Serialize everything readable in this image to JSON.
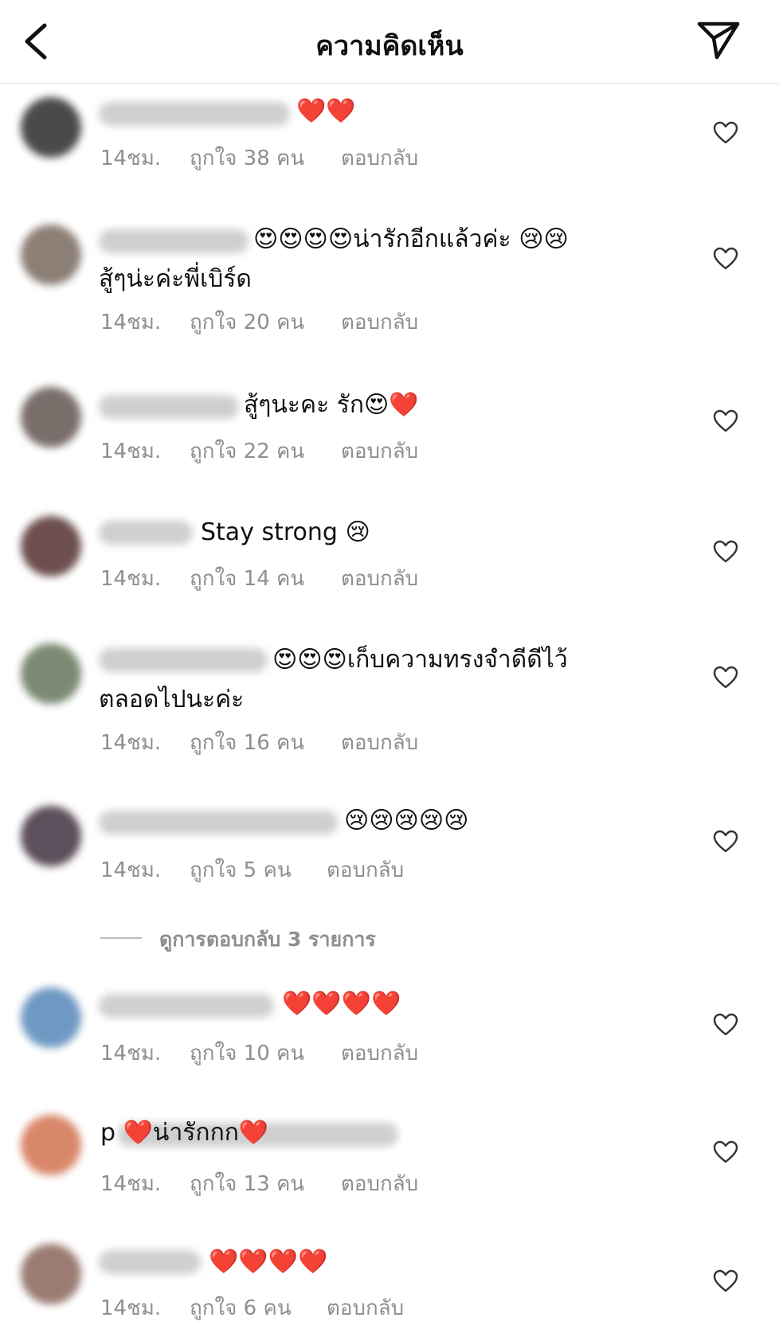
{
  "header": {
    "title": "ความคิดเห็น",
    "back_icon": "chevron-left-icon",
    "send_icon": "paper-plane-icon"
  },
  "comments": [
    {
      "text_first": "❤️❤️",
      "text_second": "",
      "time": "14ชม.",
      "likes": "ถูกใจ 38 คน",
      "reply": "ตอบกลับ",
      "avatar_color": "#4a4a4a"
    },
    {
      "text_first": "😍😍😍😍น่ารักอีกแล้วค่ะ 😢😢",
      "text_second": "สู้ๆน่ะค่ะพี่เบิร์ด",
      "time": "14ชม.",
      "likes": "ถูกใจ 20 คน",
      "reply": "ตอบกลับ",
      "avatar_color": "#8c7f76"
    },
    {
      "text_first": "สู้ๆนะคะ รัก😍❤️",
      "text_second": "",
      "time": "14ชม.",
      "likes": "ถูกใจ 22 คน",
      "reply": "ตอบกลับ",
      "avatar_color": "#7a6e6b"
    },
    {
      "text_first": "Stay strong 😢",
      "text_second": "",
      "time": "14ชม.",
      "likes": "ถูกใจ 14 คน",
      "reply": "ตอบกลับ",
      "avatar_color": "#6e4f4f"
    },
    {
      "text_first": "😍😍😍เก็บความทรงจำดีดีไว้",
      "text_second": "ตลอดไปนะค่ะ",
      "time": "14ชม.",
      "likes": "ถูกใจ 16 คน",
      "reply": "ตอบกลับ",
      "avatar_color": "#7b8a73"
    },
    {
      "text_first": "😢😢😢😢😢",
      "text_second": "",
      "time": "14ชม.",
      "likes": "ถูกใจ 5 คน",
      "reply": "ตอบกลับ",
      "avatar_color": "#5d4f5b"
    },
    {
      "text_first": "❤️❤️❤️❤️",
      "text_second": "",
      "time": "14ชม.",
      "likes": "ถูกใจ 10 คน",
      "reply": "ตอบกลับ",
      "avatar_color": "#6f99c4"
    },
    {
      "text_first": "p ❤️น่ารักกก❤️",
      "text_second": "",
      "time": "14ชม.",
      "likes": "ถูกใจ 13 คน",
      "reply": "ตอบกลับ",
      "avatar_color": "#d9876a"
    },
    {
      "text_first": "❤️❤️❤️❤️",
      "text_second": "",
      "time": "14ชม.",
      "likes": "ถูกใจ 6 คน",
      "reply": "ตอบกลับ",
      "avatar_color": "#9a7c72"
    }
  ],
  "view_replies": {
    "label": "ดูการตอบกลับ 3 รายการ"
  },
  "icons": {
    "like": "heart-outline-icon"
  }
}
